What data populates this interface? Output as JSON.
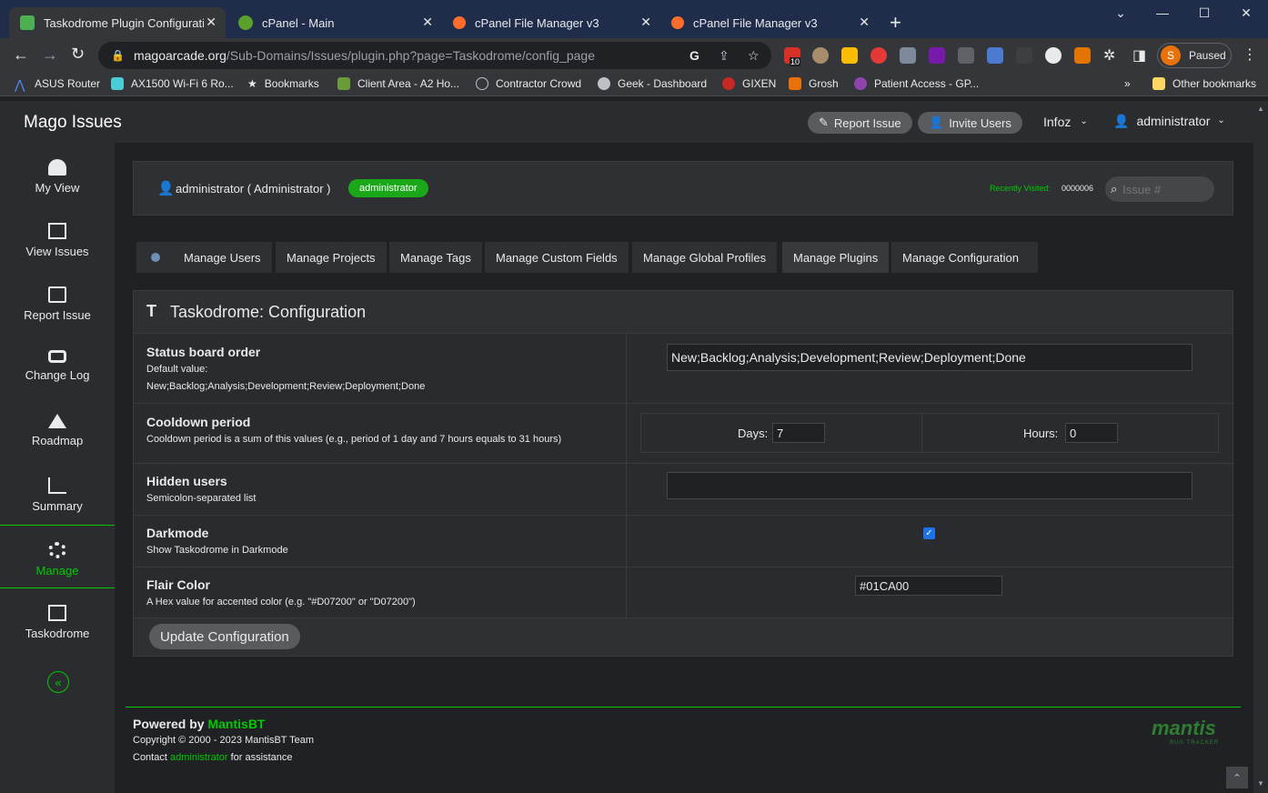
{
  "browser": {
    "tabs": [
      {
        "title": "Taskodrome Plugin Configuration",
        "active": true
      },
      {
        "title": "cPanel - Main",
        "active": false
      },
      {
        "title": "cPanel File Manager v3",
        "active": false
      },
      {
        "title": "cPanel File Manager v3",
        "active": false
      }
    ],
    "new_tab": "+",
    "url_domain": "magoarcade.org",
    "url_path": "/Sub-Domains/Issues/plugin.php?page=Taskodrome/config_page",
    "ext_badge": "10",
    "profile_initial": "S",
    "profile_status": "Paused",
    "bookmarks": [
      "ASUS Router",
      "AX1500 Wi-Fi 6 Ro...",
      "Bookmarks",
      "Client Area - A2 Ho...",
      "Contractor Crowd",
      "Geek - Dashboard",
      "GIXEN",
      "Grosh",
      "Patient Access - GP..."
    ],
    "bookmarks_overflow": "»",
    "other_bookmarks": "Other bookmarks"
  },
  "app": {
    "brand": "Mago Issues",
    "report_issue": "Report Issue",
    "invite_users": "Invite Users",
    "project": "Infoz",
    "user_menu": "administrator"
  },
  "sidebar": {
    "items": [
      {
        "label": "My View",
        "icon": "dashboard-icon"
      },
      {
        "label": "View Issues",
        "icon": "list-icon"
      },
      {
        "label": "Report Issue",
        "icon": "edit-icon"
      },
      {
        "label": "Change Log",
        "icon": "retweet-icon"
      },
      {
        "label": "Roadmap",
        "icon": "road-icon"
      },
      {
        "label": "Summary",
        "icon": "bar-chart-icon"
      },
      {
        "label": "Manage",
        "icon": "gears-icon",
        "active": true
      },
      {
        "label": "Taskodrome",
        "icon": "columns-icon"
      }
    ],
    "collapse": "«"
  },
  "userbar": {
    "user": "administrator ( Administrator )",
    "badge": "administrator",
    "recently_label": "Recently Visited:",
    "recently_value": "0000006",
    "issue_placeholder": "Issue #"
  },
  "manage_tabs": [
    "Manage Users",
    "Manage Projects",
    "Manage Tags",
    "Manage Custom Fields",
    "Manage Global Profiles",
    "Manage Plugins",
    "Manage Configuration"
  ],
  "config": {
    "title": "Taskodrome: Configuration",
    "status_order": {
      "label": "Status board order",
      "desc1": "Default value:",
      "desc2": "New;Backlog;Analysis;Development;Review;Deployment;Done",
      "value": "New;Backlog;Analysis;Development;Review;Deployment;Done"
    },
    "cooldown": {
      "label": "Cooldown period",
      "desc": "Cooldown period is a sum of this values (e.g., period of 1 day and 7 hours equals to 31 hours)",
      "days_label": "Days:",
      "days_value": "7",
      "hours_label": "Hours:",
      "hours_value": "0"
    },
    "hidden": {
      "label": "Hidden users",
      "desc": "Semicolon-separated list",
      "value": ""
    },
    "darkmode": {
      "label": "Darkmode",
      "desc": "Show Taskodrome in Darkmode",
      "checked": true
    },
    "flair": {
      "label": "Flair Color",
      "desc": "A Hex value for accented color (e.g. \"#D07200\" or \"D07200\")",
      "value": "#01CA00"
    },
    "submit": "Update Configuration"
  },
  "footer": {
    "powered": "Powered by",
    "mantis": "MantisBT",
    "copyright": "Copyright © 2000 - 2023 MantisBT Team",
    "contact_pre": "Contact",
    "contact_link": "administrator",
    "contact_post": "for assistance",
    "logo_text": "mantis",
    "logo_sub": "BUG TRACKER"
  },
  "colors": {
    "accent": "#01CA00",
    "badge": "#1aa81a"
  }
}
